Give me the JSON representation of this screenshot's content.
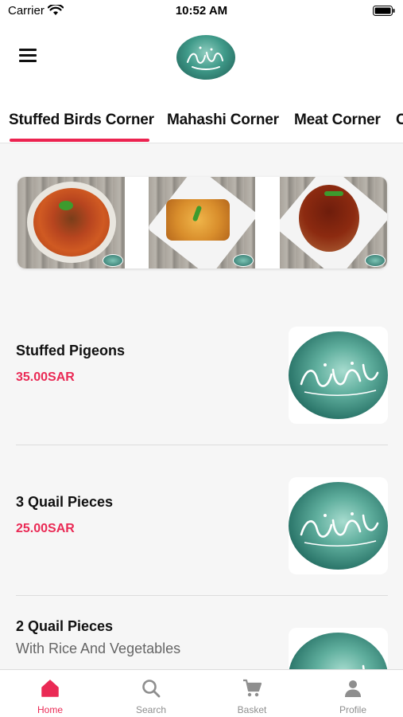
{
  "status_bar": {
    "carrier": "Carrier",
    "time": "10:52 AM"
  },
  "header": {
    "menu_icon": "hamburger-menu-icon",
    "logo_icon": "restaurant-logo-calligraphy"
  },
  "tabs": [
    {
      "label": "Stuffed Birds Corner",
      "active": true
    },
    {
      "label": "Mahashi Corner",
      "active": false
    },
    {
      "label": "Meat Corner",
      "active": false
    },
    {
      "label": "C",
      "active": false
    }
  ],
  "banner": {
    "images": [
      "meat-stew-dish-photo",
      "baked-casserole-photo",
      "stew-pot-photo"
    ]
  },
  "menu_items": [
    {
      "name": "Stuffed Pigeons",
      "price": "35.00SAR",
      "image": "restaurant-logo-calligraphy"
    },
    {
      "name": "3 Quail Pieces",
      "price": "25.00SAR",
      "image": "restaurant-logo-calligraphy"
    },
    {
      "name": "2 Quail Pieces",
      "description": "With Rice And Vegetables",
      "image": "restaurant-logo-calligraphy"
    }
  ],
  "bottom_nav": [
    {
      "label": "Home",
      "icon": "home-icon",
      "active": true
    },
    {
      "label": "Search",
      "icon": "search-icon",
      "active": false
    },
    {
      "label": "Basket",
      "icon": "cart-icon",
      "active": false
    },
    {
      "label": "Profile",
      "icon": "person-icon",
      "active": false
    }
  ],
  "colors": {
    "accent": "#ea2a55",
    "logo_teal": "#3f9a89"
  }
}
